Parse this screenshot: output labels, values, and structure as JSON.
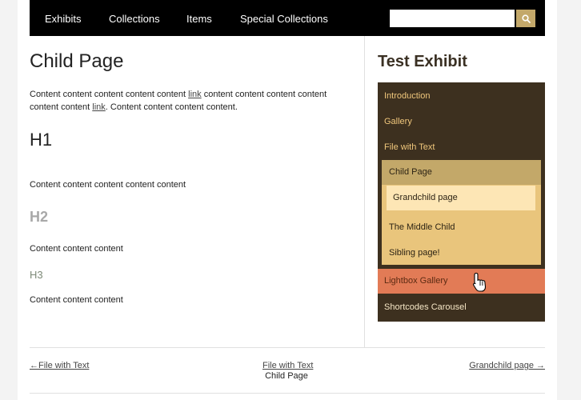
{
  "nav": {
    "items": [
      {
        "label": "Exhibits"
      },
      {
        "label": "Collections"
      },
      {
        "label": "Items"
      },
      {
        "label": "Special Collections"
      }
    ],
    "search_placeholder": ""
  },
  "main": {
    "title": "Child Page",
    "intro": {
      "t1": "Content content content content content ",
      "link1": "link",
      "t2": " content content content content content content ",
      "link2": "link",
      "t3": ". Content content content content."
    },
    "h1": "H1",
    "p2": "Content content content content content",
    "h2": "H2",
    "p3": "Content content content",
    "h3": "H3",
    "p4": "Content content content"
  },
  "sidebar": {
    "title": "Test Exhibit",
    "pages": {
      "introduction": "Introduction",
      "gallery": "Gallery",
      "file_with_text": "File with Text",
      "child_page": "Child Page",
      "grandchild_page": "Grandchild page",
      "middle_child": "The Middle Child",
      "sibling_page": "Sibling page!",
      "lightbox_gallery": "Lightbox Gallery",
      "shortcodes_carousel": "Shortcodes Carousel"
    }
  },
  "pager": {
    "prev": "←File with Text",
    "up": "File with Text",
    "current": "Child Page",
    "next": "Grandchild page →"
  },
  "colors": {
    "nav_bg": "#000000",
    "accent_gold": "#c3a86a",
    "exhibit_nav_bg": "#3d301f",
    "hover_orange": "#e27b56"
  }
}
